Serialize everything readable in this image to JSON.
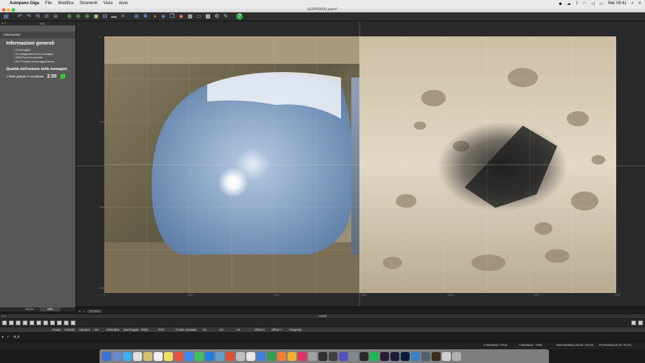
{
  "menubar": {
    "app": "Autopano Giga",
    "items": [
      "File",
      "Modifica",
      "Strumenti",
      "Vista",
      "Aiuto"
    ],
    "clock": "Mar 09:41"
  },
  "window": {
    "title": "GOPR0000.pano*"
  },
  "left_panel": {
    "tabs": [
      "Informazioni",
      "Info"
    ],
    "section_label": "Informazioni",
    "general_title": "Informazioni generali",
    "general_items": [
      "• 13 immagini",
      "• 16 collegamenti tra le immagini",
      "• 4643 Punti di controllo",
      "• 50.2 Tornata di sovrapposizione"
    ],
    "quality_title": "Qualità dell'unione delle immagini",
    "rms_label": "1 RMS globale è eccellente",
    "rms_value": "2.50",
    "bottom_tabs": [
      "Storia",
      "Info"
    ]
  },
  "viewer": {
    "zoom": "24.39%",
    "x_ticks": [
      "0",
      "1000",
      "2000",
      "3000",
      "4000",
      "5000",
      "6000"
    ],
    "y_ticks": [
      "0",
      "1000",
      "2000",
      "3000"
    ]
  },
  "layers_panel": {
    "title": "Livelli",
    "columns": [
      "Focale",
      "Velocità",
      "Apertura",
      "Iso",
      "Imbardata",
      "Beccheggio",
      "Rollio",
      "FOV",
      "Focale calcolata",
      "K1",
      "K2",
      "K3",
      "Offset X",
      "Offset Y",
      "Viewpoint"
    ],
    "row_label": "N_0"
  },
  "status": {
    "x_minmax": "X Min/Max(0 / 5912)",
    "y_minmax": "Y Min/Max(0 / 2956)",
    "theta": "Theta Min/Max(-180.00 / 180.00)",
    "phi": "Phi Min/Max(-90.00 / 90.00)"
  },
  "colors": {
    "panel": "#575757",
    "accent_green": "#3cc03c",
    "background": "#1a1a1a"
  }
}
